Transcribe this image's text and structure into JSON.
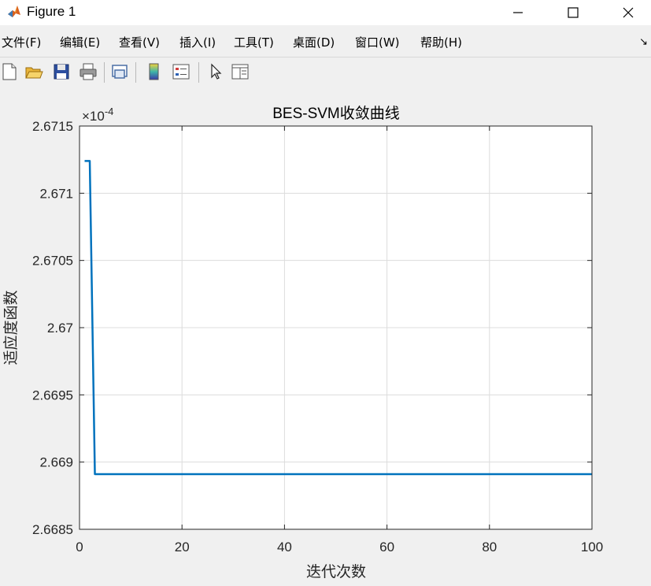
{
  "window": {
    "title": "Figure 1",
    "icon": "matlab-logo-icon",
    "controls": [
      "minimize-icon",
      "maximize-icon",
      "close-icon"
    ]
  },
  "menu": {
    "items": [
      "文件(F)",
      "编辑(E)",
      "查看(V)",
      "插入(I)",
      "工具(T)",
      "桌面(D)",
      "窗口(W)",
      "帮助(H)"
    ],
    "overflow_arrow": "↘"
  },
  "toolbar": {
    "buttons": [
      "new-figure-icon",
      "open-file-icon",
      "save-icon",
      "print-icon",
      "link-plot-icon",
      "insert-colorbar-icon",
      "insert-legend-icon",
      "edit-plot-pointer-icon",
      "property-inspector-icon"
    ]
  },
  "colors": {
    "line": "#0072bd",
    "grid": "#dcdcdc",
    "axes": "#262626",
    "figure_bg": "#f0f0f0",
    "plot_bg": "#ffffff"
  },
  "chart_data": {
    "type": "line",
    "title": "BES-SVM收敛曲线",
    "xlabel": "迭代次数",
    "ylabel": "适应度函数",
    "y_exponent_label": "×10",
    "y_exponent_power": "-4",
    "xlim": [
      0,
      100
    ],
    "ylim": [
      2.6685,
      2.6715
    ],
    "xticks": [
      0,
      20,
      40,
      60,
      80,
      100
    ],
    "xtick_labels": [
      "0",
      "20",
      "40",
      "60",
      "80",
      "100"
    ],
    "yticks": [
      2.6685,
      2.669,
      2.6695,
      2.67,
      2.6705,
      2.671,
      2.6715
    ],
    "ytick_labels": [
      "2.6685",
      "2.669",
      "2.6695",
      "2.67",
      "2.6705",
      "2.671",
      "2.6715"
    ],
    "grid": true,
    "series": [
      {
        "x": [
          1,
          2,
          3,
          100
        ],
        "y": [
          2.67124,
          2.67124,
          2.66891,
          2.66891
        ]
      }
    ]
  }
}
